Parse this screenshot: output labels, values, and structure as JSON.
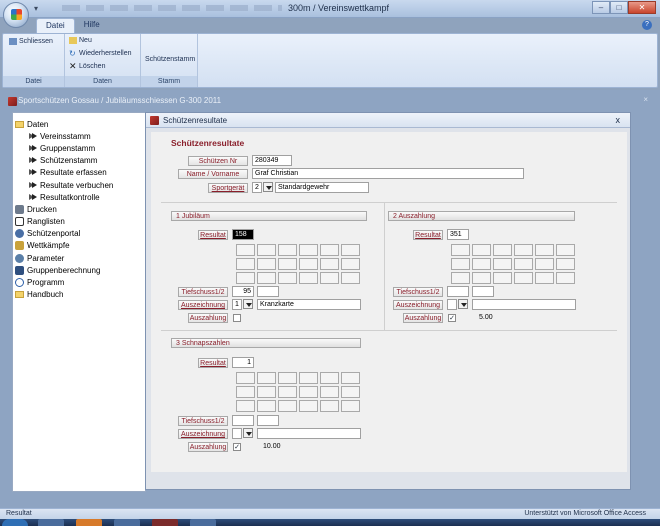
{
  "window": {
    "title": "300m / Vereinswettkampf",
    "controls": [
      "–",
      "□",
      "✕"
    ]
  },
  "ribbon": {
    "tabs": [
      {
        "label": "Datei"
      },
      {
        "label": "Hilfe"
      }
    ],
    "help_icon": "?",
    "groups": {
      "datei": {
        "label": "Datei",
        "close_label": "Schliessen"
      },
      "daten": {
        "label": "Daten",
        "new_label": "Neu",
        "restore_label": "Wiederherstellen",
        "delete_label": "Löschen"
      },
      "stamm": {
        "label": "Stamm",
        "shooter_label": "Schützenstamm"
      }
    }
  },
  "document": {
    "breadcrumb": "Sportschützen Gossau  /  Jubiläumsschiessen G-300 2011",
    "close_symbol": "×"
  },
  "navigation": {
    "items": [
      {
        "label": "Daten",
        "icon": "folder-icon",
        "level": 0
      },
      {
        "label": "Vereinsstamm",
        "icon": "arrow-icon",
        "level": 1
      },
      {
        "label": "Gruppenstamm",
        "icon": "arrow-icon",
        "level": 1
      },
      {
        "label": "Schützenstamm",
        "icon": "arrow-icon",
        "level": 1
      },
      {
        "label": "Resultate erfassen",
        "icon": "arrow-icon",
        "level": 1
      },
      {
        "label": "Resultate verbuchen",
        "icon": "arrow-icon",
        "level": 1
      },
      {
        "label": "Resultatkontrolle",
        "icon": "arrow-icon",
        "level": 1
      },
      {
        "label": "Drucken",
        "icon": "printer-icon",
        "level": 0
      },
      {
        "label": "Ranglisten",
        "icon": "list-icon",
        "level": 0
      },
      {
        "label": "Schützenportal",
        "icon": "portal-icon",
        "level": 0
      },
      {
        "label": "Wettkämpfe",
        "icon": "contest-icon",
        "level": 0
      },
      {
        "label": "Parameter",
        "icon": "parameter-icon",
        "level": 0
      },
      {
        "label": "Gruppenberechnung",
        "icon": "group-calc-icon",
        "level": 0
      },
      {
        "label": "Programm",
        "icon": "program-icon",
        "level": 0
      },
      {
        "label": "Handbuch",
        "icon": "folder-icon",
        "level": 0
      }
    ]
  },
  "form": {
    "title": "Schützenresultate",
    "heading": "Schützenresultate",
    "close_symbol": "x",
    "schuetzen_nr": {
      "label": "Schützen Nr",
      "value": "280349"
    },
    "name": {
      "label": "Name / Vorname",
      "value": "Graf Christian"
    },
    "sportgeraet": {
      "label": "Sportgerät",
      "code": "2",
      "value": "Standardgewehr"
    },
    "sections": {
      "jubilaeum": {
        "title": "1 Jubiläum",
        "resultat_label": "Resultat",
        "resultat": "158",
        "tiefschuss_label": "Tiefschuss1/2",
        "tiefschuss": "95",
        "auszeichnung_label": "Auszeichnung",
        "auszeichnung_code": "1",
        "auszeichnung_value": "Kranzkarte",
        "auszahlung_label": "Auszahlung",
        "auszahlung_checked": "",
        "auszahlung_amount": ""
      },
      "auszahlung2": {
        "title": "2 Auszahlung",
        "resultat_label": "Resultat",
        "resultat": "351",
        "tiefschuss_label": "Tiefschuss1/2",
        "tiefschuss": "",
        "auszeichnung_label": "Auszeichnung",
        "auszeichnung_code": "",
        "auszeichnung_value": "",
        "auszahlung_label": "Auszahlung",
        "auszahlung_checked": "✓",
        "auszahlung_amount": "5.00"
      },
      "schnapszahlen": {
        "title": "3 Schnapszahlen",
        "resultat_label": "Resultat",
        "resultat": "1",
        "tiefschuss_label": "Tiefschuss1/2",
        "tiefschuss": "",
        "auszeichnung_label": "Auszeichnung",
        "auszeichnung_code": "",
        "auszeichnung_value": "",
        "auszahlung_label": "Auszahlung",
        "auszahlung_checked": "✓",
        "auszahlung_amount": "10.00"
      }
    }
  },
  "status": {
    "left": "Resultat",
    "right": "Unterstützt von Microsoft Office Access"
  },
  "colors": {
    "label_text": "#8a1f2b",
    "accent": "#c43a2f"
  }
}
